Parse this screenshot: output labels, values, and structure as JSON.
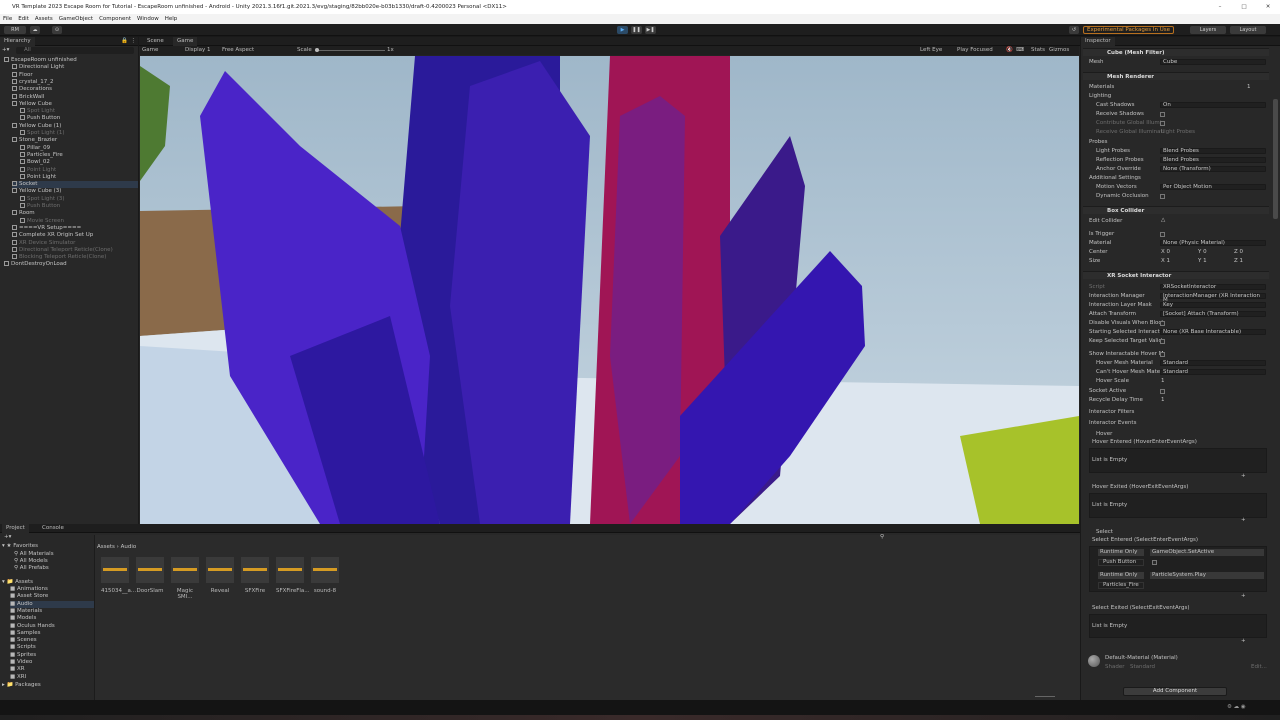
{
  "window": {
    "title": "VR Template 2023 Escape Room for Tutorial - EscapeRoom unfinished - Android - Unity 2021.3.16f1.git.2021.3/evg/staging/82bb020e-b03b1330/draft-0.4200023 Personal <DX11>"
  },
  "menu": [
    "File",
    "Edit",
    "Assets",
    "GameObject",
    "Component",
    "Window",
    "Help"
  ],
  "toolbar": {
    "account": "RM",
    "experimental": "Experimental Packages In Use",
    "layers": "Layers",
    "layout": "Layout"
  },
  "hierarchy": {
    "tab": "Hierarchy",
    "search_placeholder": "All",
    "items": [
      {
        "label": "EscapeRoom unfinished",
        "indent": 0,
        "dim": false
      },
      {
        "label": "Directional Light",
        "indent": 1,
        "dim": false
      },
      {
        "label": "Floor",
        "indent": 1,
        "dim": false
      },
      {
        "label": "crystal_17_2",
        "indent": 1,
        "dim": false
      },
      {
        "label": "Decorations",
        "indent": 1,
        "dim": false
      },
      {
        "label": "BrickWall",
        "indent": 1,
        "dim": false
      },
      {
        "label": "Yellow Cube",
        "indent": 1,
        "dim": false
      },
      {
        "label": "Spot Light",
        "indent": 2,
        "dim": true
      },
      {
        "label": "Push Button",
        "indent": 2,
        "dim": false
      },
      {
        "label": "Yellow Cube (1)",
        "indent": 1,
        "dim": false
      },
      {
        "label": "Spot Light (1)",
        "indent": 2,
        "dim": true
      },
      {
        "label": "Stone_Brazier",
        "indent": 1,
        "dim": false
      },
      {
        "label": "Pillar_09",
        "indent": 2,
        "dim": false
      },
      {
        "label": "Particles_Fire",
        "indent": 2,
        "dim": false
      },
      {
        "label": "Bowl_02",
        "indent": 2,
        "dim": false
      },
      {
        "label": "Point Light",
        "indent": 2,
        "dim": true
      },
      {
        "label": "Point Light",
        "indent": 2,
        "dim": false
      },
      {
        "label": "Socket",
        "indent": 1,
        "dim": false
      },
      {
        "label": "Yellow Cube (3)",
        "indent": 1,
        "dim": false
      },
      {
        "label": "Spot Light (3)",
        "indent": 2,
        "dim": true
      },
      {
        "label": "Push Button",
        "indent": 2,
        "dim": true
      },
      {
        "label": "Room",
        "indent": 1,
        "dim": false
      },
      {
        "label": "Movie Screen",
        "indent": 2,
        "dim": true
      },
      {
        "label": "====VR Setup====",
        "indent": 1,
        "dim": false
      },
      {
        "label": "Complete XR Origin Set Up",
        "indent": 1,
        "dim": false
      },
      {
        "label": "XR Device Simulator",
        "indent": 1,
        "dim": true
      },
      {
        "label": "Directional Teleport Reticle(Clone)",
        "indent": 1,
        "dim": true
      },
      {
        "label": "Blocking Teleport Reticle(Clone)",
        "indent": 1,
        "dim": true
      },
      {
        "label": "DontDestroyOnLoad",
        "indent": 0,
        "dim": false
      }
    ]
  },
  "center": {
    "tabs": [
      "Scene",
      "Game"
    ],
    "game_bar": {
      "mode": "Game",
      "display": "Display 1",
      "aspect": "Free Aspect",
      "scale_label": "Scale",
      "scale_value": "1x",
      "eye": "Left Eye",
      "play": "Play Focused",
      "stats": "Stats",
      "gizmos": "Gizmos"
    }
  },
  "inspector": {
    "tab": "Inspector",
    "mesh_filter": {
      "title": "Cube (Mesh Filter)",
      "mesh_label": "Mesh",
      "mesh_value": "Cube"
    },
    "mesh_renderer": {
      "title": "Mesh Renderer",
      "materials_label": "Materials",
      "materials_count": "1",
      "lighting": "Lighting",
      "cast_shadows": "Cast Shadows",
      "cast_shadows_value": "On",
      "receive_shadows": "Receive Shadows",
      "contribute_gi": "Contribute Global Illumin",
      "receive_gi": "Receive Global Illuminati",
      "receive_gi_value": "Light Probes",
      "probes": "Probes",
      "light_probes": "Light Probes",
      "light_probes_value": "Blend Probes",
      "reflection_probes": "Reflection Probes",
      "reflection_probes_value": "Blend Probes",
      "anchor_override": "Anchor Override",
      "anchor_override_value": "None (Transform)",
      "additional": "Additional Settings",
      "motion_vectors": "Motion Vectors",
      "motion_vectors_value": "Per Object Motion",
      "dynamic_occlusion": "Dynamic Occlusion"
    },
    "box_collider": {
      "title": "Box Collider",
      "edit": "Edit Collider",
      "is_trigger": "Is Trigger",
      "material": "Material",
      "material_value": "None (Physic Material)",
      "center": "Center",
      "center_x": "0",
      "center_y": "0",
      "center_z": "0",
      "size": "Size",
      "size_x": "1",
      "size_y": "1",
      "size_z": "1"
    },
    "xr_socket": {
      "title": "XR Socket Interactor",
      "script": "Script",
      "script_value": "XRSocketInteractor",
      "manager": "Interaction Manager",
      "manager_value": "InteractionManager (XR Interaction M",
      "layer_mask": "Interaction Layer Mask",
      "layer_mask_value": "Key",
      "attach": "Attach Transform",
      "attach_value": "[Socket] Attach (Transform)",
      "disable_visuals": "Disable Visuals When Block",
      "starting_selected": "Starting Selected Interactal",
      "starting_selected_value": "None (XR Base Interactable)",
      "keep_selected": "Keep Selected Target Valid",
      "show_hover": "Show Interactable Hover M",
      "hover_mesh": "Hover Mesh Material",
      "hover_mesh_value": "Standard",
      "cant_hover": "Can't Hover Mesh Mater",
      "cant_hover_value": "Standard",
      "hover_scale": "Hover Scale",
      "hover_scale_value": "1",
      "socket_active": "Socket Active",
      "recycle": "Recycle Delay Time",
      "recycle_value": "1",
      "filters": "Interactor Filters",
      "events": "Interactor Events",
      "hover": "Hover",
      "hover_entered": "Hover Entered (HoverEnterEventArgs)",
      "list_empty": "List is Empty",
      "hover_exited": "Hover Exited (HoverExitEventArgs)",
      "select": "Select",
      "select_entered": "Select Entered (SelectEnterEventArgs)",
      "runtime_only": "Runtime Only",
      "fn1": "GameObject.SetActive",
      "obj1": "Push Button",
      "fn2": "ParticleSystem.Play",
      "obj2": "Particles_Fire",
      "select_exited": "Select Exited (SelectExitEventArgs)"
    },
    "material": {
      "name": "Default-Material (Material)",
      "shader_label": "Shader",
      "shader_value": "Standard",
      "edit": "Edit..."
    },
    "add_component": "Add Component"
  },
  "project": {
    "tabs": [
      "Project",
      "Console"
    ],
    "favorites": "Favorites",
    "fav_items": [
      "All Materials",
      "All Models",
      "All Prefabs"
    ],
    "assets": "Assets",
    "folders": [
      "Animations",
      "Asset Store",
      "Audio",
      "Materials",
      "Models",
      "Oculus Hands",
      "Samples",
      "Scenes",
      "Scripts",
      "Sprites",
      "Video",
      "XR",
      "XRI"
    ],
    "packages": "Packages",
    "breadcrumb": [
      "Assets",
      "Audio"
    ],
    "files": [
      "415034__a...",
      "DoorSlam",
      "Magic SMI...",
      "Reveal",
      "SFXFire",
      "SFXFireFla...",
      "sound-8"
    ]
  },
  "colors": {
    "accent": "#3d6b99",
    "warning": "#e39a3a",
    "waveform": "#d59b23"
  }
}
